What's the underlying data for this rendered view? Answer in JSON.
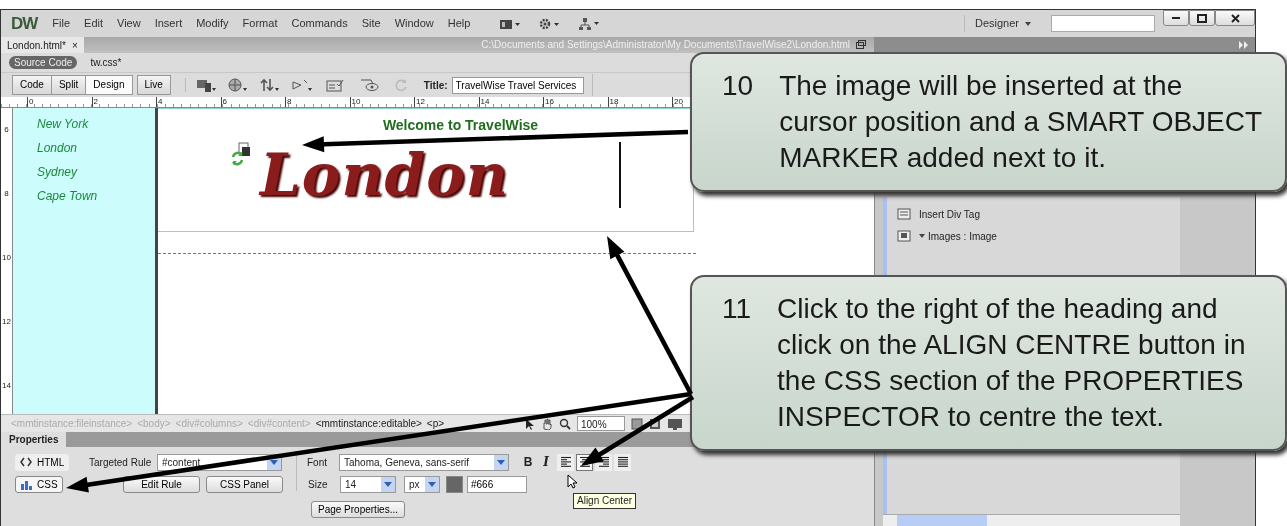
{
  "menubar": {
    "logo": "DW",
    "menus": [
      "File",
      "Edit",
      "View",
      "Insert",
      "Modify",
      "Format",
      "Commands",
      "Site",
      "Window",
      "Help"
    ],
    "workspace": "Designer"
  },
  "document_tab": {
    "label": "London.html*",
    "close": "×",
    "path": "C:\\Documents and Settings\\Administrator\\My Documents\\TravelWise2\\London.html"
  },
  "related_files": [
    {
      "label": "Source Code",
      "selected": true
    },
    {
      "label": "tw.css*",
      "selected": false
    }
  ],
  "view_buttons": [
    {
      "label": "Code",
      "selected": false
    },
    {
      "label": "Split",
      "selected": false
    },
    {
      "label": "Design",
      "selected": true
    },
    {
      "label": "Live",
      "selected": false
    }
  ],
  "title_field": {
    "label": "Title:",
    "value": "TravelWise Travel Services"
  },
  "ruler": {
    "horizontal": [
      "0",
      "2",
      "4",
      "6",
      "8",
      "10",
      "12",
      "14",
      "16",
      "18",
      "20"
    ],
    "vertical": [
      "6",
      "8",
      "10",
      "12",
      "14"
    ]
  },
  "page": {
    "nav": [
      "New York",
      "London",
      "Sydney",
      "Cape Town"
    ],
    "heading": "Welcome to TravelWise",
    "banner_text": "London"
  },
  "tag_selector": {
    "tags": [
      {
        "label": "<mmtinstance:fileinstance>",
        "disabled": true
      },
      {
        "label": "<body>",
        "disabled": true
      },
      {
        "label": "<div#columns>",
        "disabled": true
      },
      {
        "label": "<div#content>",
        "disabled": true
      },
      {
        "label": "<mmtinstance:editable>",
        "disabled": false
      },
      {
        "label": "<p>",
        "disabled": false
      }
    ],
    "zoom": "100%"
  },
  "properties": {
    "title": "Properties",
    "modes": [
      {
        "label": "HTML",
        "selected": false
      },
      {
        "label": "CSS",
        "selected": true
      }
    ],
    "targeted_rule_label": "Targeted Rule",
    "targeted_rule": "#content",
    "buttons": [
      "Edit Rule",
      "CSS Panel"
    ],
    "font_label": "Font",
    "font": "Tahoma, Geneva, sans-serif",
    "bold": "B",
    "italic": "I",
    "align": [
      {
        "kind": "left",
        "selected": false
      },
      {
        "kind": "center",
        "selected": true
      },
      {
        "kind": "right",
        "selected": false
      },
      {
        "kind": "justify",
        "selected": false
      }
    ],
    "size_label": "Size",
    "size": "14",
    "unit": "px",
    "color": "#666",
    "tooltip": "Align Center",
    "page_properties": "Page Properties..."
  },
  "insert_panel": {
    "items": [
      "Insert Div Tag",
      "Images : Image"
    ]
  },
  "callouts": [
    {
      "number": "10",
      "text": "The image will be inserted at the cursor position and a SMART OBJECT MARKER added next to it."
    },
    {
      "number": "11",
      "text": "Click to the right of the heading and click on the ALIGN CENTRE button in the CSS section of the PROPERTIES INSPECTOR to centre the text."
    }
  ]
}
